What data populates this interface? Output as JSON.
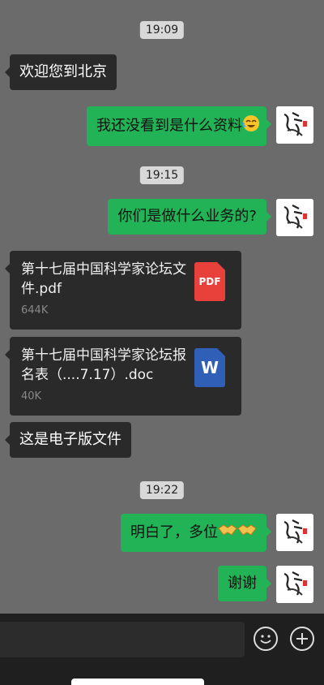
{
  "messages": {
    "t1": "19:09",
    "m1": "欢迎您到北京",
    "m2": "我还没看到是什么资料",
    "t2": "19:15",
    "m3": "你们是做什么业务的?",
    "f1_name": "第十七届中国科学家论坛文件.pdf",
    "f1_size": "644K",
    "f1_icon": "PDF",
    "f2_name": "第十七届中国科学家论坛报名表（....7.17）.doc",
    "f2_size": "40K",
    "f2_icon": "W",
    "m4": "这是电子版文件",
    "t3": "19:22",
    "m5": "明白了，多位",
    "m6": "谢谢"
  },
  "icons": {
    "input_bar": [
      "emoji-icon",
      "add-icon"
    ],
    "emoji": [
      "laughing-crying-face-icon",
      "handshake-icon"
    ],
    "file": [
      "pdf-file-icon",
      "word-file-icon"
    ]
  },
  "colors": {
    "background": "#6b6b6b",
    "outgoing_bubble": "#22b356",
    "incoming_bubble": "#2a2a2a",
    "pdf": "#e8413c",
    "word": "#2f5fb7"
  }
}
